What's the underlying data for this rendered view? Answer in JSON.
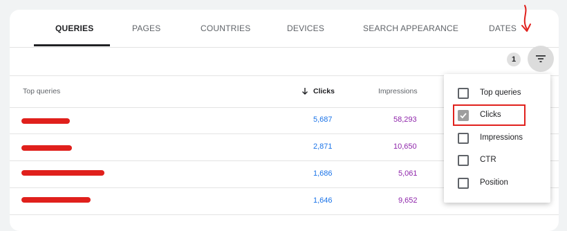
{
  "tabs": [
    {
      "label": "QUERIES",
      "active": true
    },
    {
      "label": "PAGES",
      "active": false
    },
    {
      "label": "COUNTRIES",
      "active": false
    },
    {
      "label": "DEVICES",
      "active": false
    },
    {
      "label": "SEARCH APPEARANCE",
      "active": false
    },
    {
      "label": "DATES",
      "active": false
    }
  ],
  "toolbar": {
    "filter_count": "1",
    "filter_icon": "filter-icon"
  },
  "table": {
    "headers": {
      "query": "Top queries",
      "clicks": "Clicks",
      "impressions": "Impressions"
    },
    "sort_icon": "arrow-down-icon",
    "rows": [
      {
        "clicks": "5,687",
        "impressions": "58,293"
      },
      {
        "clicks": "2,871",
        "impressions": "10,650"
      },
      {
        "clicks": "1,686",
        "impressions": "5,061"
      },
      {
        "clicks": "1,646",
        "impressions": "9,652"
      }
    ]
  },
  "menu": {
    "options": [
      {
        "label": "Top queries",
        "checked": false
      },
      {
        "label": "Clicks",
        "checked": true
      },
      {
        "label": "Impressions",
        "checked": false
      },
      {
        "label": "CTR",
        "checked": false
      },
      {
        "label": "Position",
        "checked": false
      }
    ]
  },
  "colors": {
    "clicks": "#1a73e8",
    "impressions": "#8e24aa",
    "annotation": "#e0201c"
  }
}
